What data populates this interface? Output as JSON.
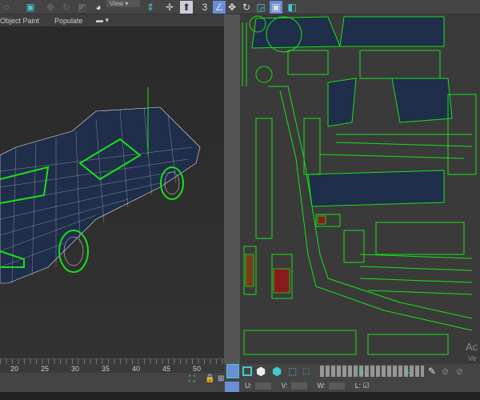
{
  "toolbar": {
    "view_dropdown": "View",
    "icons": [
      "select-region-icon",
      "select-icon",
      "move-icon",
      "rotate-icon",
      "scale-icon",
      "snap-icon",
      "view-dropdown",
      "mirror-icon",
      "move-gizmo-icon",
      "align-icon",
      "snap-3-icon",
      "angle-snap-icon"
    ]
  },
  "ribbon": {
    "object_paint": "Object Paint",
    "populate": "Populate"
  },
  "timeline": {
    "ticks": [
      "20",
      "25",
      "30",
      "35",
      "40",
      "45",
      "50"
    ]
  },
  "uv_editor": {
    "coords": {
      "u_label": "U:",
      "v_label": "V:",
      "w_label": "W:",
      "l_label": "L:",
      "u": "",
      "v": "",
      "w": ""
    },
    "watermark_line1": "Ac",
    "watermark_line2": "Ve a"
  },
  "colors": {
    "accent": "#46c8d0",
    "uv_green": "#18e018",
    "selection_blue": "#6a8ed8"
  }
}
